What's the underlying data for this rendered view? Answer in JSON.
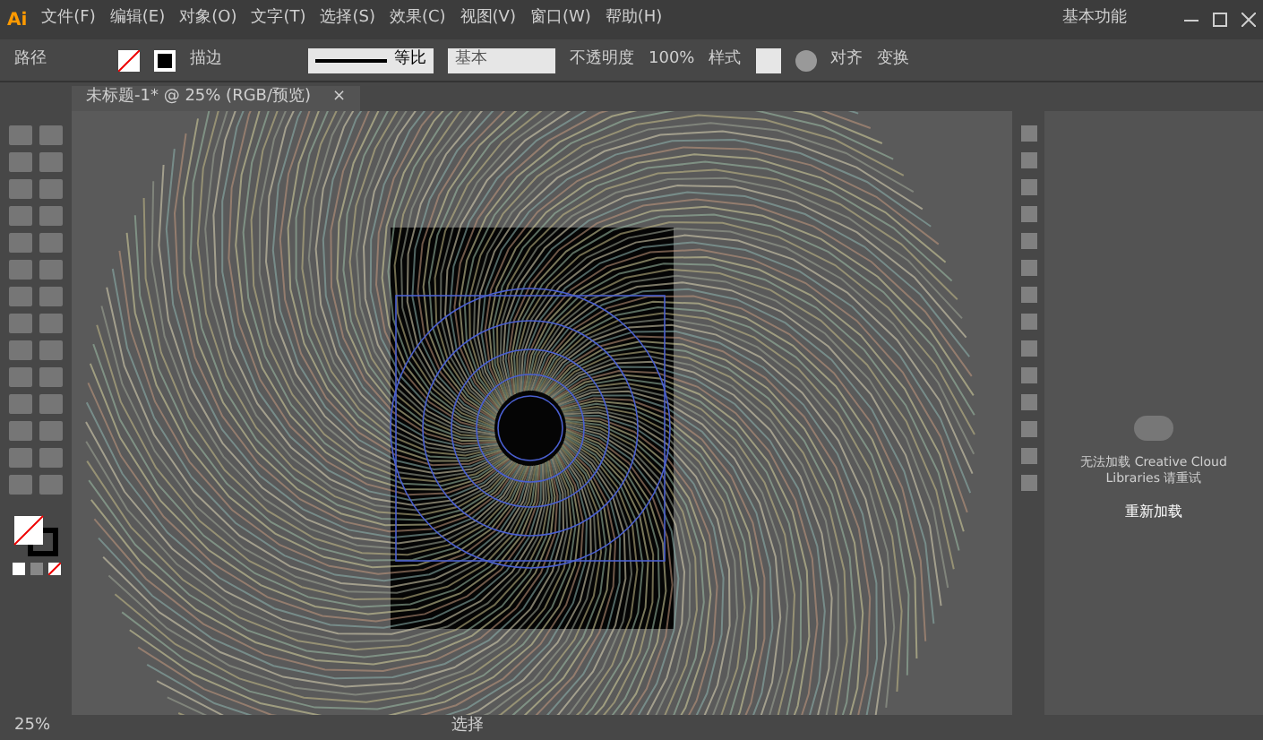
{
  "app": {
    "logo": "Ai",
    "menu": [
      "文件(F)",
      "编辑(E)",
      "对象(O)",
      "文字(T)",
      "选择(S)",
      "效果(C)",
      "视图(V)",
      "窗口(W)",
      "帮助(H)"
    ],
    "workspace": "基本功能"
  },
  "control_bar": {
    "object_label": "路径",
    "stroke_label": "描边",
    "stroke_profile": "等比",
    "brush": "基本",
    "opacity_label": "不透明度",
    "opacity": "100%",
    "style_label": "样式",
    "align": "对齐",
    "transform": "变换"
  },
  "document_tab": {
    "title": "未标题-1* @ 25% (RGB/预览)",
    "close": "×"
  },
  "libraries_panel": {
    "message": "无法加载 Creative Cloud Libraries 请重试",
    "button": "重新加载"
  },
  "status_bar": {
    "zoom": "25%",
    "tool": "选择"
  }
}
